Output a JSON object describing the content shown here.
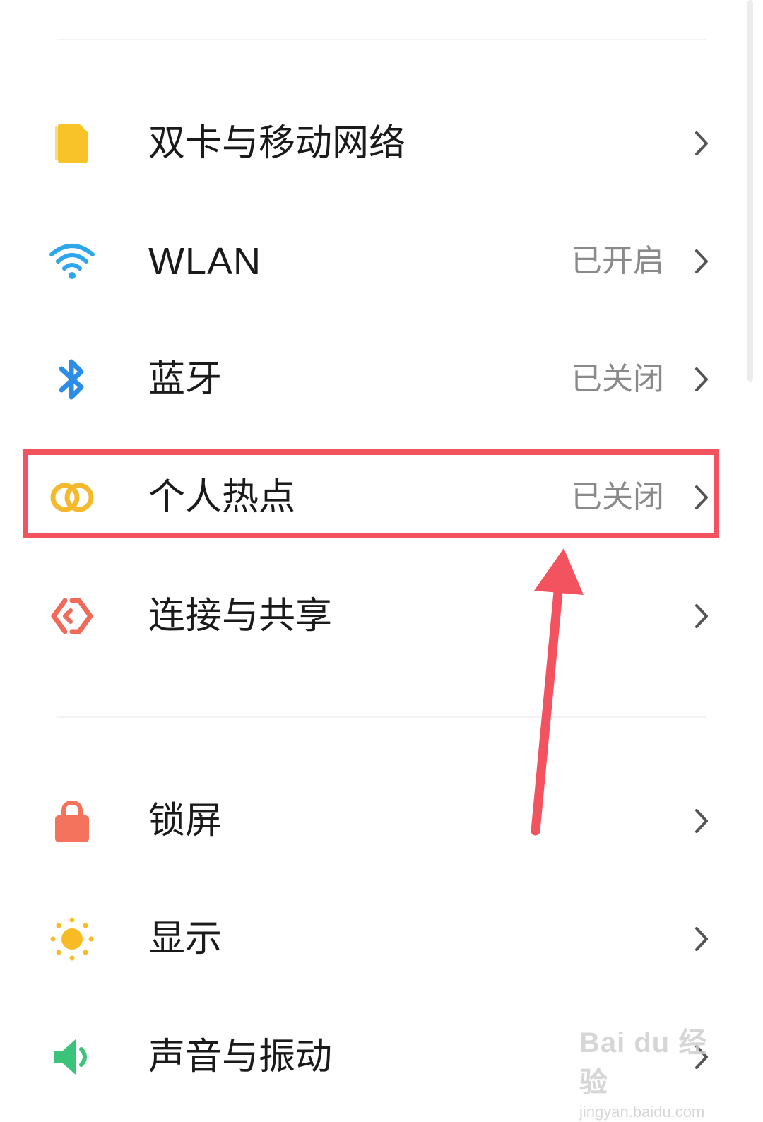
{
  "settings": {
    "items": [
      {
        "label": "双卡与移动网络",
        "status": "",
        "icon": "sim-card-icon",
        "color": "#f7c328"
      },
      {
        "label": "WLAN",
        "status": "已开启",
        "icon": "wifi-icon",
        "color": "#2ea6ec"
      },
      {
        "label": "蓝牙",
        "status": "已关闭",
        "icon": "bluetooth-icon",
        "color": "#2b8de6"
      },
      {
        "label": "个人热点",
        "status": "已关闭",
        "icon": "hotspot-icon",
        "color": "#f5b92e"
      },
      {
        "label": "连接与共享",
        "status": "",
        "icon": "connection-share-icon",
        "color": "#f06a5a"
      },
      {
        "label": "锁屏",
        "status": "",
        "icon": "lock-icon",
        "color": "#f4735c"
      },
      {
        "label": "显示",
        "status": "",
        "icon": "sun-icon",
        "color": "#f8bb26"
      },
      {
        "label": "声音与振动",
        "status": "",
        "icon": "speaker-icon",
        "color": "#3cc37a"
      }
    ],
    "highlighted_item": "个人热点"
  },
  "annotation": {
    "color": "#f2535f",
    "target": "个人热点"
  },
  "watermark": {
    "brand": "Bai du 经验",
    "site": "jingyan.baidu.com"
  }
}
